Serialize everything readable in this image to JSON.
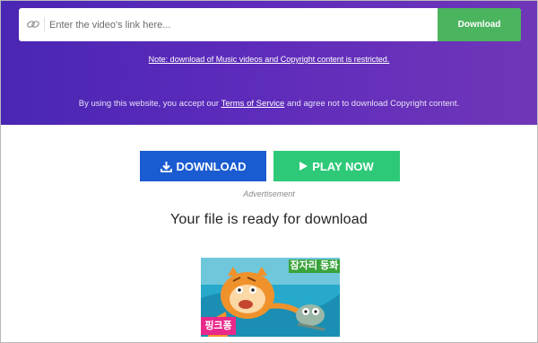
{
  "search": {
    "placeholder": "Enter the video's link here...",
    "button_label": "Download",
    "icon": "link-icon"
  },
  "notice": {
    "restriction_note": "Note: download of Music videos and Copyright content is restricted.",
    "terms_prefix": "By using this website, you accept our ",
    "terms_link": "Terms of Service",
    "terms_suffix": " and agree not to download Copyright content."
  },
  "actions": {
    "download_label": "DOWNLOAD",
    "download_icon": "download-icon",
    "play_label": "PLAY NOW",
    "play_icon": "play-icon",
    "advertisement_label": "Advertisement"
  },
  "result": {
    "title": "Your file is ready for download",
    "thumbnail_label_top": "잠자리 동화",
    "thumbnail_label_bottom": "핑크퐁"
  },
  "colors": {
    "hero_gradient_start": "#4a26b4",
    "hero_gradient_end": "#7036b8",
    "download_top": "#4bb45e",
    "download_button": "#1a5bd1",
    "play_button": "#2ec978"
  }
}
